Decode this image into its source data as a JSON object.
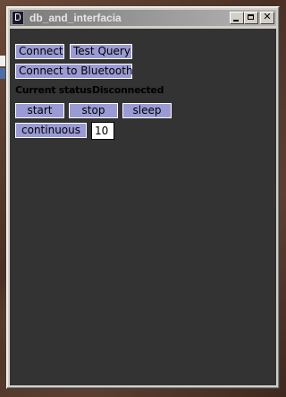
{
  "window": {
    "title": "db_and_interfacia"
  },
  "buttons": {
    "connect": "Connect",
    "test_query": "Test Query",
    "connect_bluetooth": "Connect to Bluetooth",
    "start": "start",
    "stop": "stop",
    "sleep": "sleep",
    "continuous": "continuous"
  },
  "status": {
    "label": "Current status:",
    "value": "Disconnected"
  },
  "continuous_value": "10",
  "colors": {
    "button_bg": "#9a9ad4",
    "client_bg": "#333333",
    "titlebar": "#9a9a9a"
  }
}
